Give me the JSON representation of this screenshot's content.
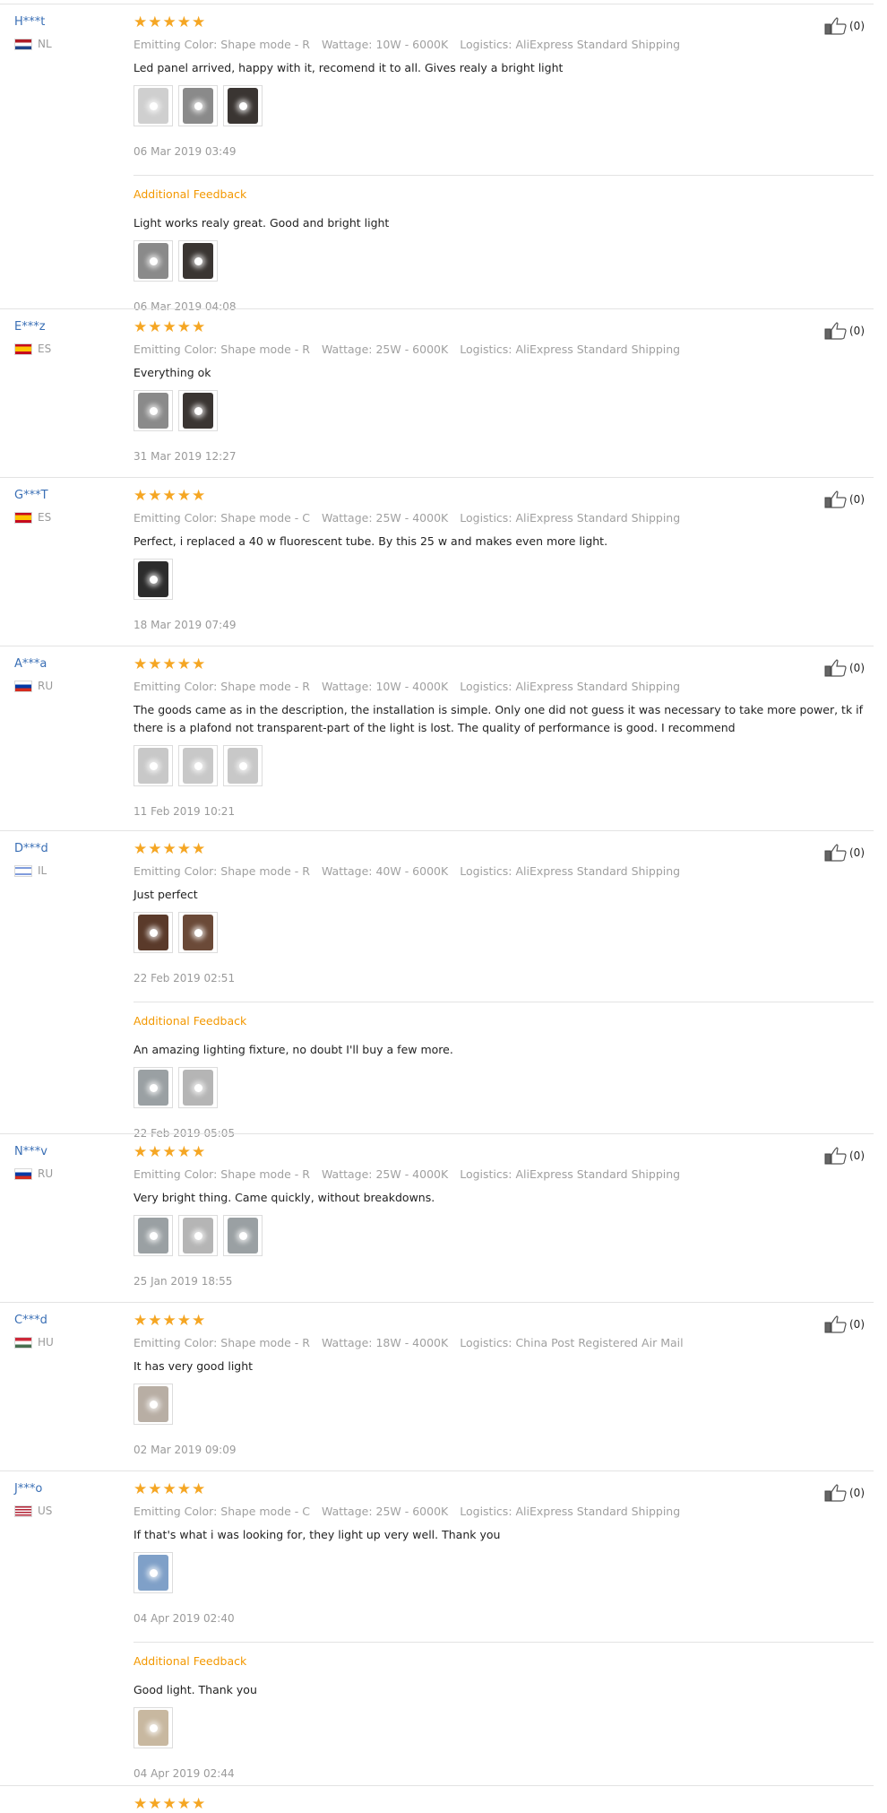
{
  "like_icon": "thumbs-up-icon",
  "reviews": [
    {
      "user": "H***t",
      "country": "NL",
      "stars": "★★★★★",
      "emitting_color": "Emitting Color: Shape mode - R",
      "wattage": "Wattage: 10W - 6000K",
      "logistics": "Logistics: AliExpress Standard Shipping",
      "text": "Led panel arrived, happy with it, recomend it to all. Gives realy a bright light",
      "date": "06 Mar 2019 03:49",
      "likes": "(0)",
      "images": 3,
      "additional": {
        "label": "Additional Feedback",
        "text": "Light works realy great. Good and bright light",
        "date": "06 Mar 2019 04:08",
        "images": 2
      }
    },
    {
      "user": "E***z",
      "country": "ES",
      "stars": "★★★★★",
      "emitting_color": "Emitting Color: Shape mode - R",
      "wattage": "Wattage: 25W - 6000K",
      "logistics": "Logistics: AliExpress Standard Shipping",
      "text": "Everything ok",
      "date": "31 Mar 2019 12:27",
      "likes": "(0)",
      "images": 2
    },
    {
      "user": "G***T",
      "country": "ES",
      "stars": "★★★★★",
      "emitting_color": "Emitting Color: Shape mode - C",
      "wattage": "Wattage: 25W - 4000K",
      "logistics": "Logistics: AliExpress Standard Shipping",
      "text": "Perfect, i replaced a 40 w fluorescent tube. By this 25 w and makes even more light.",
      "date": "18 Mar 2019 07:49",
      "likes": "(0)",
      "images": 1
    },
    {
      "user": "A***a",
      "country": "RU",
      "stars": "★★★★★",
      "emitting_color": "Emitting Color: Shape mode - R",
      "wattage": "Wattage: 10W - 4000K",
      "logistics": "Logistics: AliExpress Standard Shipping",
      "text": "The goods came as in the description, the installation is simple. Only one did not guess it was necessary to take more power, tk if there is a plafond not transparent-part of the light is lost. The quality of performance is good. I recommend",
      "date": "11 Feb 2019 10:21",
      "likes": "(0)",
      "images": 3
    },
    {
      "user": "D***d",
      "country": "IL",
      "stars": "★★★★★",
      "emitting_color": "Emitting Color: Shape mode - R",
      "wattage": "Wattage: 40W - 6000K",
      "logistics": "Logistics: AliExpress Standard Shipping",
      "text": "Just perfect",
      "date": "22 Feb 2019 02:51",
      "likes": "(0)",
      "images": 2,
      "additional": {
        "label": "Additional Feedback",
        "text": "An amazing lighting fixture, no doubt I'll buy a few more.",
        "date": "22 Feb 2019 05:05",
        "images": 2
      }
    },
    {
      "user": "N***v",
      "country": "RU",
      "stars": "★★★★★",
      "emitting_color": "Emitting Color: Shape mode - R",
      "wattage": "Wattage: 25W - 4000K",
      "logistics": "Logistics: AliExpress Standard Shipping",
      "text": "Very bright thing. Came quickly, without breakdowns.",
      "date": "25 Jan 2019 18:55",
      "likes": "(0)",
      "images": 3
    },
    {
      "user": "C***d",
      "country": "HU",
      "stars": "★★★★★",
      "emitting_color": "Emitting Color: Shape mode - R",
      "wattage": "Wattage: 18W - 4000K",
      "logistics": "Logistics: China Post Registered Air Mail",
      "text": "It has very good light",
      "date": "02 Mar 2019 09:09",
      "likes": "(0)",
      "images": 1
    },
    {
      "user": "J***o",
      "country": "US",
      "stars": "★★★★★",
      "emitting_color": "Emitting Color: Shape mode - C",
      "wattage": "Wattage: 25W - 6000K",
      "logistics": "Logistics: AliExpress Standard Shipping",
      "text": "If that's what i was looking for, they light up very well. Thank you",
      "date": "04 Apr 2019 02:40",
      "likes": "(0)",
      "images": 1,
      "additional": {
        "label": "Additional Feedback",
        "text": "Good light. Thank you",
        "date": "04 Apr 2019 02:44",
        "images": 1
      }
    },
    {
      "user": "",
      "country": "",
      "stars": "★★★★★",
      "emitting_color": "",
      "wattage": "",
      "logistics": "",
      "text": "",
      "date": "",
      "likes": "",
      "images": 0
    }
  ]
}
